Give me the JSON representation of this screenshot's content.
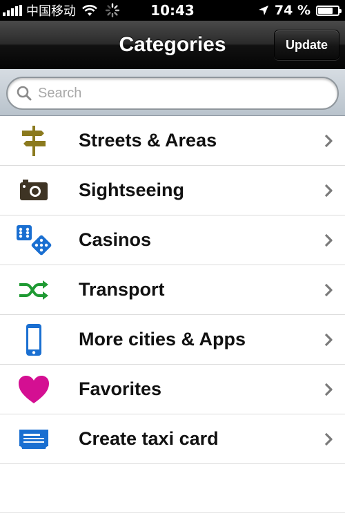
{
  "status_bar": {
    "carrier": "中国移动",
    "time": "10:43",
    "battery_percent_label": "74 %",
    "battery_level": 0.74
  },
  "nav": {
    "title": "Categories",
    "update_label": "Update"
  },
  "search": {
    "placeholder": "Search",
    "value": ""
  },
  "categories": [
    {
      "label": "Streets & Areas",
      "icon": "signpost-icon",
      "color": "#8b7a1e"
    },
    {
      "label": "Sightseeing",
      "icon": "camera-icon",
      "color": "#3e3424"
    },
    {
      "label": "Casinos",
      "icon": "dice-icon",
      "color": "#1a6fd1"
    },
    {
      "label": "Transport",
      "icon": "shuffle-icon",
      "color": "#1f9a33"
    },
    {
      "label": "More cities & Apps",
      "icon": "phone-icon",
      "color": "#1a6fd1"
    },
    {
      "label": "Favorites",
      "icon": "heart-icon",
      "color": "#d40f92"
    },
    {
      "label": "Create taxi card",
      "icon": "ticket-icon",
      "color": "#1a6fd1"
    }
  ]
}
